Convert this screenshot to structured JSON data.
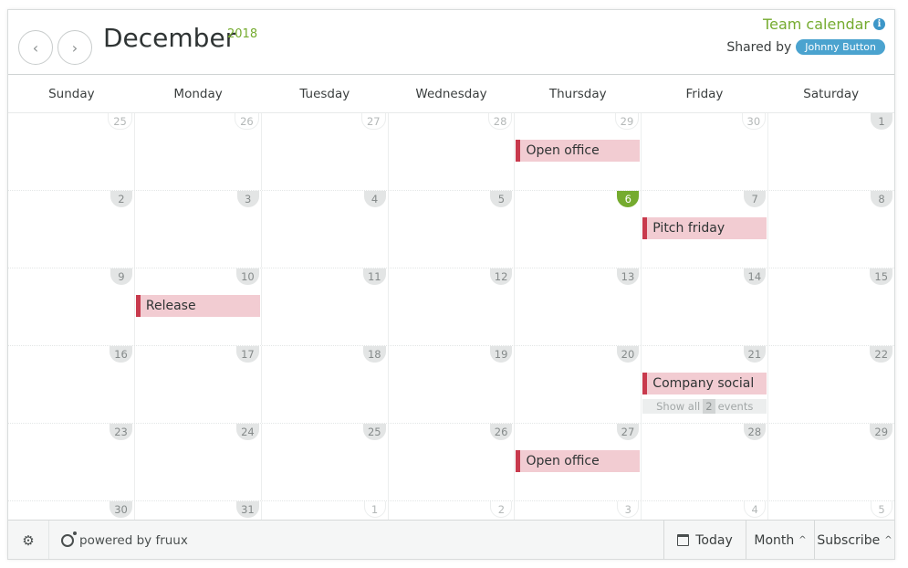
{
  "header": {
    "prev_label": "‹",
    "next_label": "›",
    "month": "December",
    "year": "2018",
    "calendar_name": "Team calendar",
    "shared_by_label": "Shared by",
    "shared_by_user": "Johnny Button"
  },
  "weekdays": [
    "Sunday",
    "Monday",
    "Tuesday",
    "Wednesday",
    "Thursday",
    "Friday",
    "Saturday"
  ],
  "weeks": [
    [
      "25",
      "26",
      "27",
      "28",
      "29",
      "30",
      "1"
    ],
    [
      "2",
      "3",
      "4",
      "5",
      "6",
      "7",
      "8"
    ],
    [
      "9",
      "10",
      "11",
      "12",
      "13",
      "14",
      "15"
    ],
    [
      "16",
      "17",
      "18",
      "19",
      "20",
      "21",
      "22"
    ],
    [
      "23",
      "24",
      "25",
      "26",
      "27",
      "28",
      "29"
    ],
    [
      "30",
      "31",
      "1",
      "2",
      "3",
      "4",
      "5"
    ]
  ],
  "today": "6",
  "events": {
    "nov29": "Open office",
    "dec7": "Pitch friday",
    "dec10": "Release",
    "dec21": "Company social",
    "dec27": "Open office"
  },
  "show_all": {
    "prefix": "Show all",
    "count": "2",
    "suffix": "events"
  },
  "footer": {
    "powered_by": "powered by fruux",
    "today_label": "Today",
    "month_label": "Month",
    "subscribe_label": "Subscribe"
  },
  "colors": {
    "accent_green": "#75ab2f",
    "event_bg": "#f2ccd2",
    "event_border": "#c83a4d",
    "badge_blue": "#4ba3cf"
  }
}
